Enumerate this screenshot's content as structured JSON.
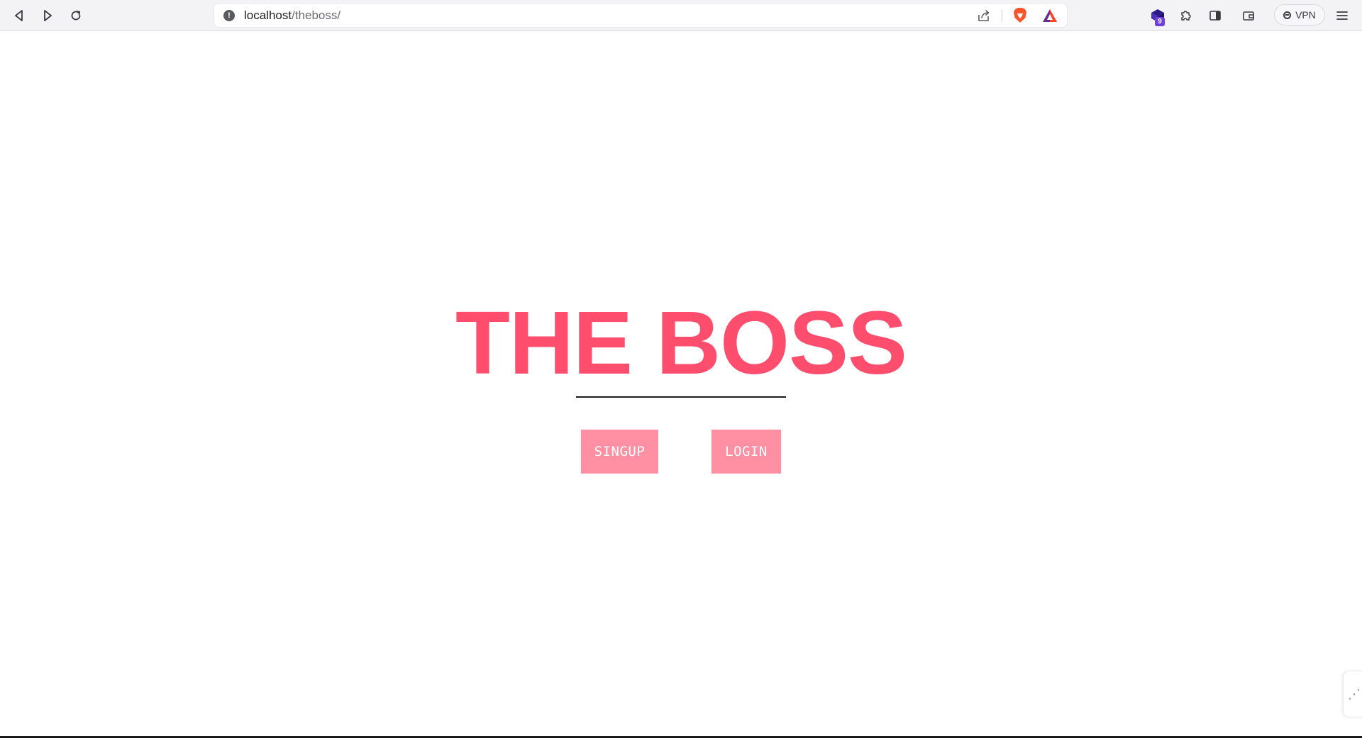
{
  "browser": {
    "url_host": "localhost",
    "url_path": "/theboss/",
    "extensions_badge_count": "9",
    "vpn_label": "VPN",
    "icons": {
      "back": "back-icon",
      "forward": "forward-icon",
      "reload": "reload-icon",
      "site_info": "info-icon",
      "share": "share-icon",
      "brave_shields": "brave-lion-icon",
      "brave_rewards": "bat-triangle-icon",
      "extension": "extension-cube-icon",
      "extensions_menu": "puzzle-icon",
      "sidebar": "sidebar-icon",
      "wallet": "wallet-icon",
      "menu": "hamburger-menu-icon"
    }
  },
  "page": {
    "title": "THE BOSS",
    "signup_label": "SINGUP",
    "login_label": "LOGIN",
    "colors": {
      "title": "#ff4d6d",
      "button_bg": "#ff8fa3",
      "underline": "#1c1c1c"
    }
  }
}
